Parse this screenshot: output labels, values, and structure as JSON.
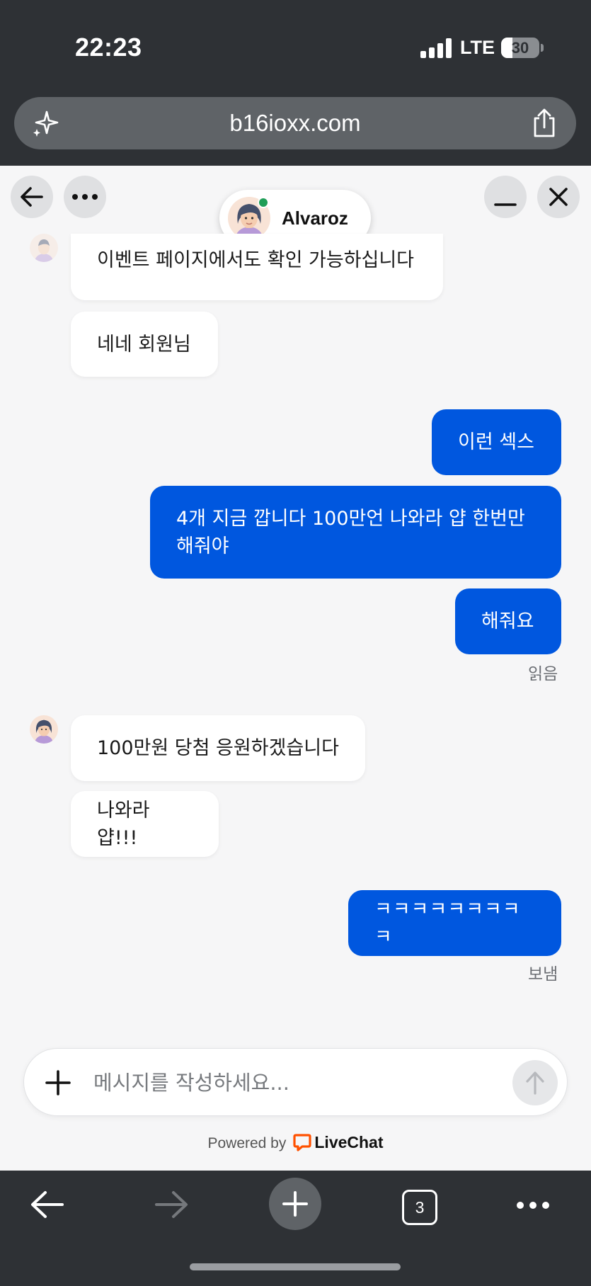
{
  "status_bar": {
    "time": "22:23",
    "network": "LTE",
    "battery": "30",
    "battery_level": 0.3
  },
  "browser": {
    "url": "b16ioxx.com",
    "tab_count": "3"
  },
  "chat_header": {
    "agent_name": "Alvaroz"
  },
  "messages": [
    {
      "side": "in",
      "text": "이벤트 페이지에서도 확인 가능하십니다"
    },
    {
      "side": "in",
      "text": "네네 회원님"
    },
    {
      "side": "out",
      "text": "이런 섹스"
    },
    {
      "side": "out",
      "text": "4개 지금 깝니다 100만언 나와라 얍 한번만 해줘야"
    },
    {
      "side": "out",
      "text": "해줘요"
    },
    {
      "side": "in",
      "text": "100만원 당첨 응원하겠습니다"
    },
    {
      "side": "in",
      "text": "나와라 얍!!!"
    },
    {
      "side": "out",
      "text": "ㅋㅋㅋㅋㅋㅋㅋㅋㅋ"
    }
  ],
  "status_labels": {
    "read": "읽음",
    "sent": "보냄"
  },
  "composer": {
    "placeholder": "메시지를 작성하세요..."
  },
  "footer": {
    "powered_by": "Powered by",
    "brand": "LiveChat",
    "brand_color": "#ff5100"
  },
  "colors": {
    "outgoing_bubble": "#0057df",
    "online_dot": "#1f9e57"
  }
}
